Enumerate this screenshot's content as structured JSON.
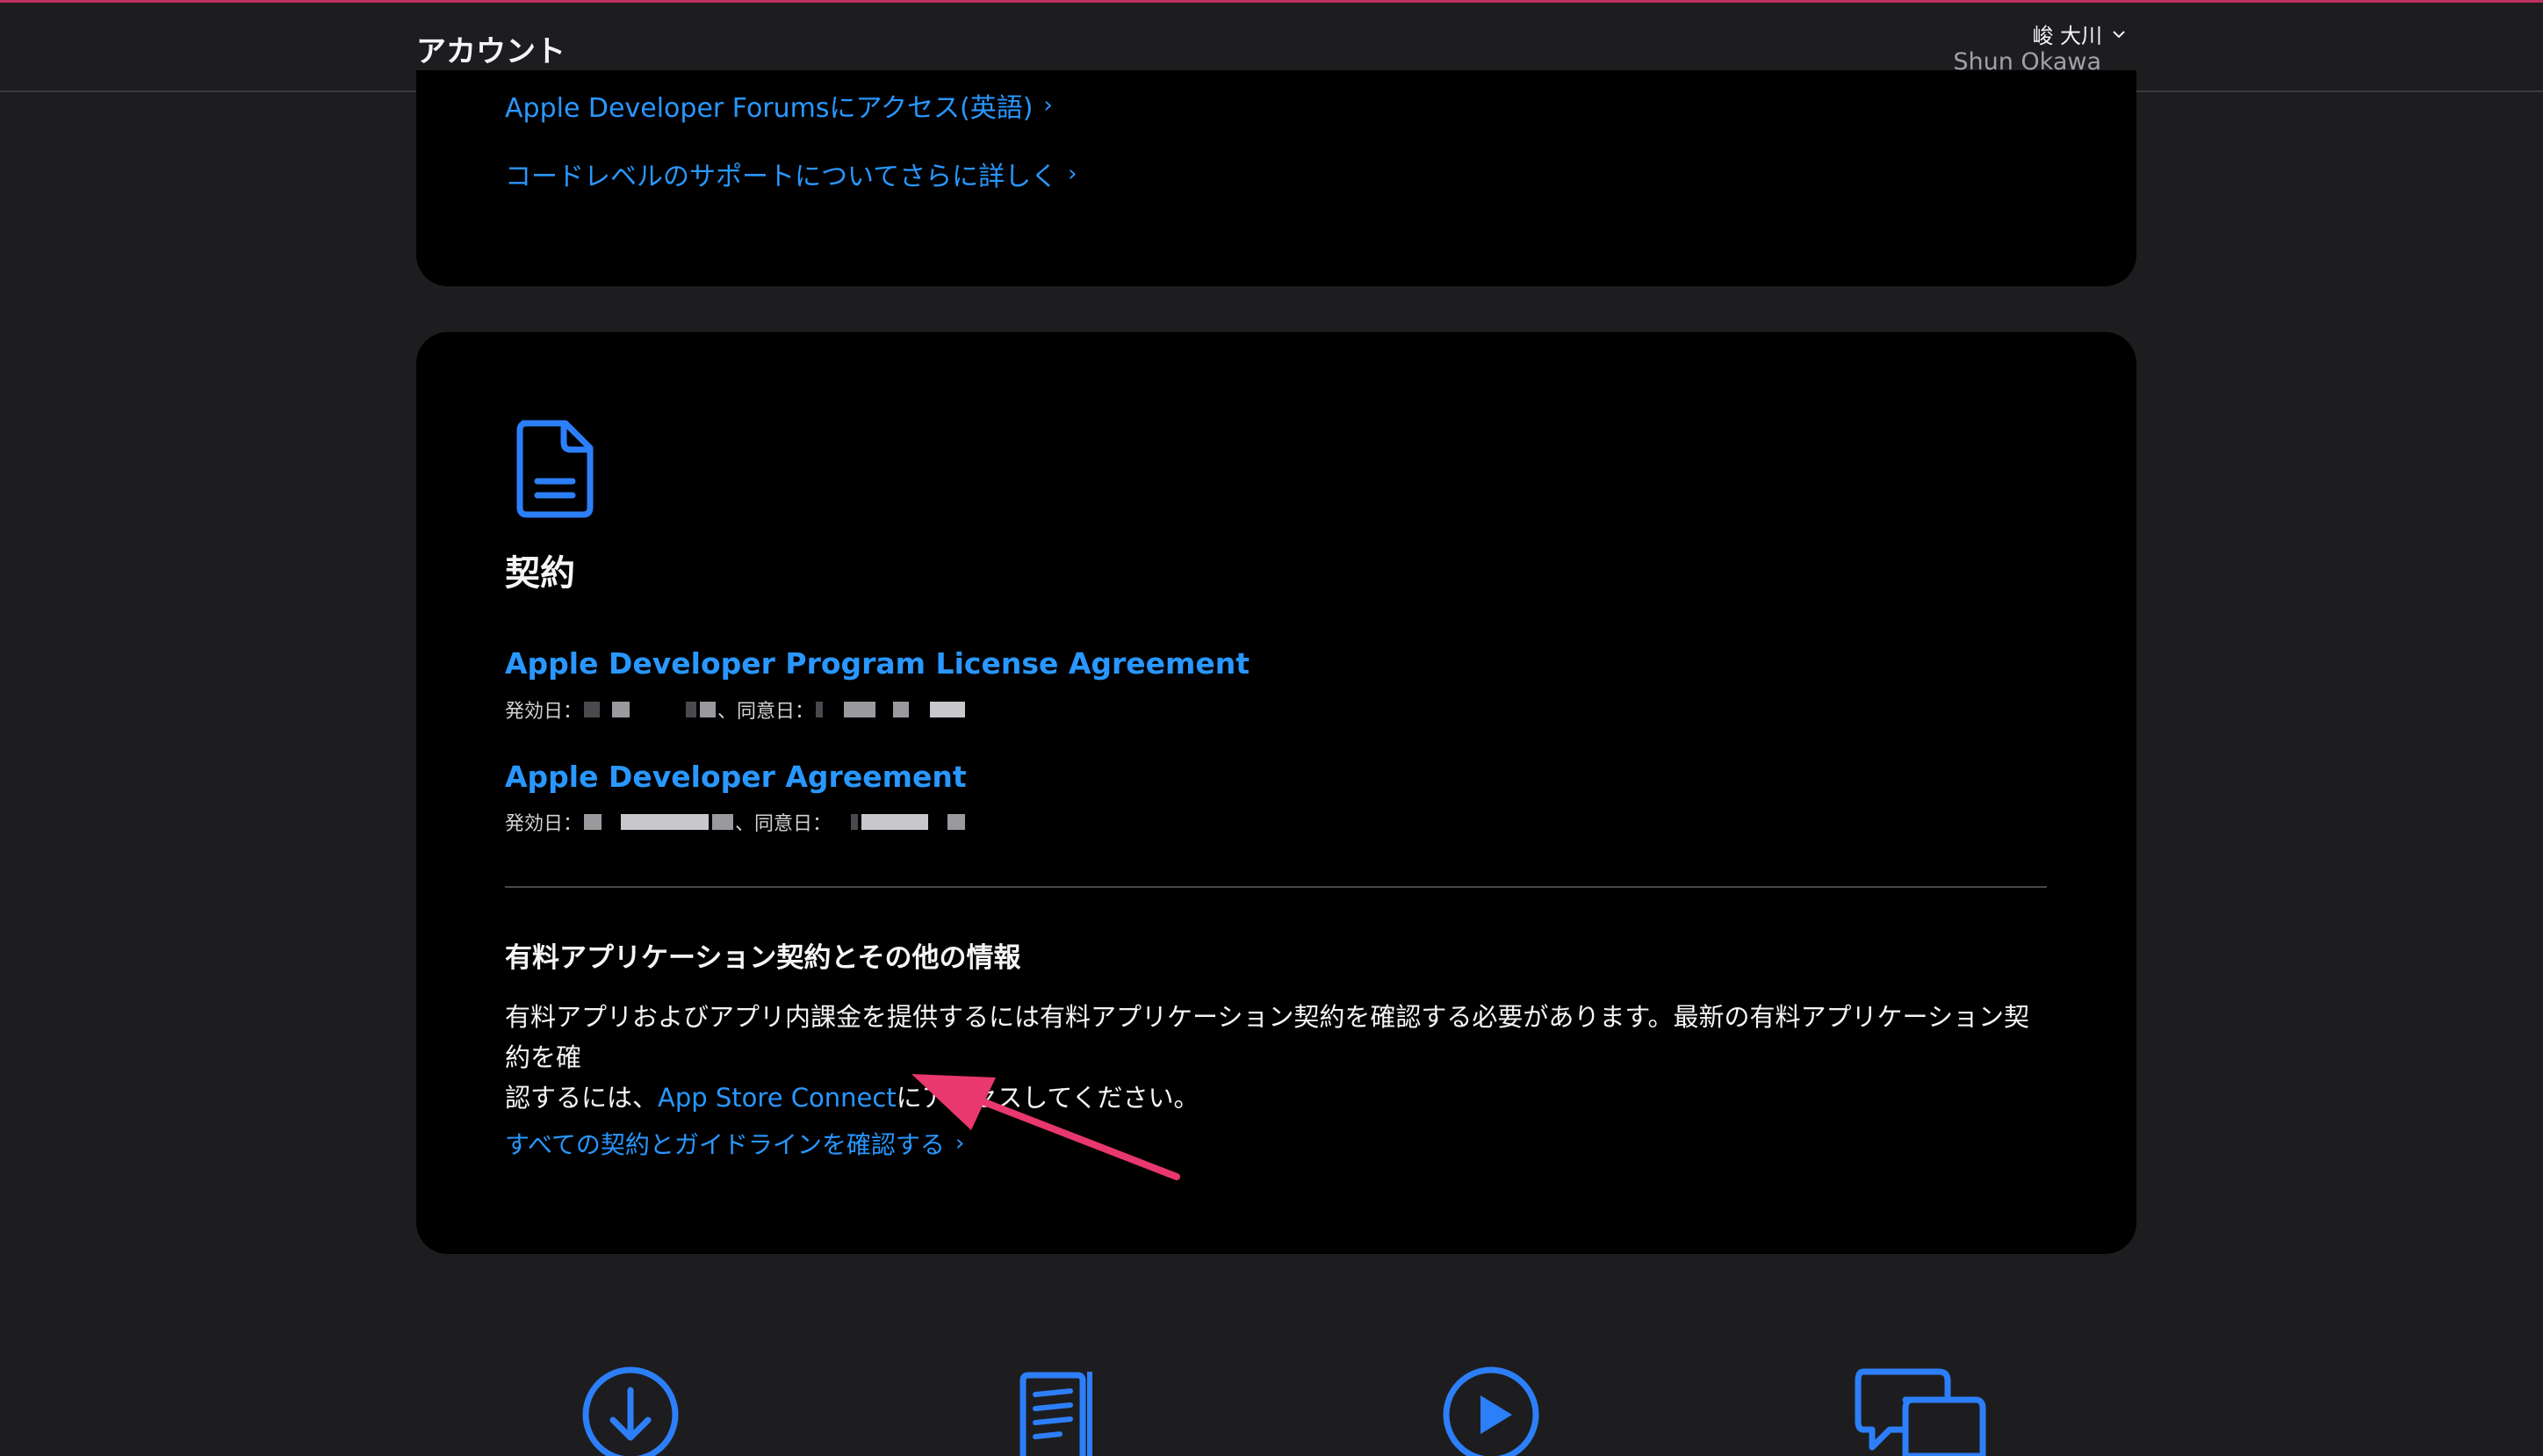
{
  "header": {
    "title": "アカウント",
    "user_name_ja": "峻 大川",
    "user_name_en": "Shun Okawa"
  },
  "support_card": {
    "forums_link": "Apple Developer Forumsにアクセス(英語)",
    "code_support_link": "コードレベルのサポートについてさらに詳しく"
  },
  "agreements_card": {
    "icon": "document-icon",
    "title": "契約",
    "agreements": [
      {
        "title": "Apple Developer Program License Agreement",
        "issued_label": "発効日：",
        "agreed_label": "、同意日："
      },
      {
        "title": "Apple Developer Agreement",
        "issued_label": "発効日：",
        "agreed_label": "、同意日："
      }
    ],
    "paid_apps": {
      "title": "有料アプリケーション契約とその他の情報",
      "text_line1": "有料アプリおよびアプリ内課金を提供するには有料アプリケーション契約を確認する必要があります。最新の有料アプリケーション契約を確",
      "text_line2_prefix": "認するには、",
      "app_store_connect_link": "App Store Connect",
      "text_line2_suffix": "にアクセスしてください。"
    },
    "all_agreements_link": "すべての契約とガイドラインを確認する"
  },
  "bottom_icons": [
    "download-icon",
    "documentation-icon",
    "play-icon",
    "forums-icon"
  ],
  "colors": {
    "background": "#1d1d1f",
    "card": "#000000",
    "link": "#2997ff",
    "arrow": "#e8386d",
    "icon_blue": "#2d7ff9"
  }
}
